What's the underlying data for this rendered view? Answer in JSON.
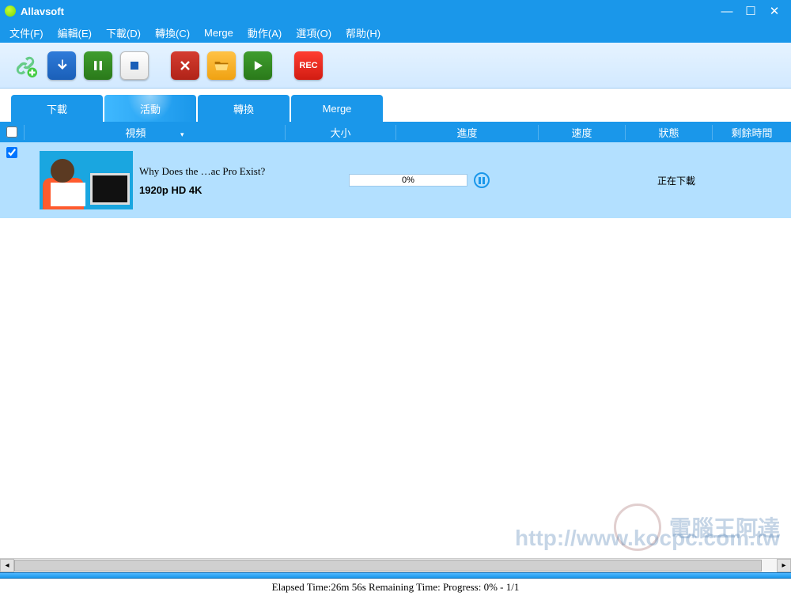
{
  "app": {
    "title": "Allavsoft"
  },
  "window": {
    "min": "—",
    "max": "☐",
    "close": "✕"
  },
  "menu": [
    "文件(F)",
    "編輯(E)",
    "下載(D)",
    "轉換(C)",
    "Merge",
    "動作(A)",
    "選項(O)",
    "帮助(H)"
  ],
  "toolbar": {
    "rec": "REC"
  },
  "tabs": [
    "下載",
    "活動",
    "轉換",
    "Merge"
  ],
  "columns": {
    "video": "視頻",
    "size": "大小",
    "progress": "進度",
    "speed": "速度",
    "status": "狀態",
    "remain": "剩餘時間"
  },
  "rows": [
    {
      "checked": true,
      "title": "Why Does the …ac Pro Exist?",
      "quality": "1920p HD 4K",
      "progress_pct": "0%",
      "status": "正在下載"
    }
  ],
  "statusbar": "Elapsed Time:26m 56s Remaining Time: Progress: 0% - 1/1",
  "watermark": {
    "text": "電腦王阿達",
    "url": "http://www.kocpc.com.tw"
  }
}
